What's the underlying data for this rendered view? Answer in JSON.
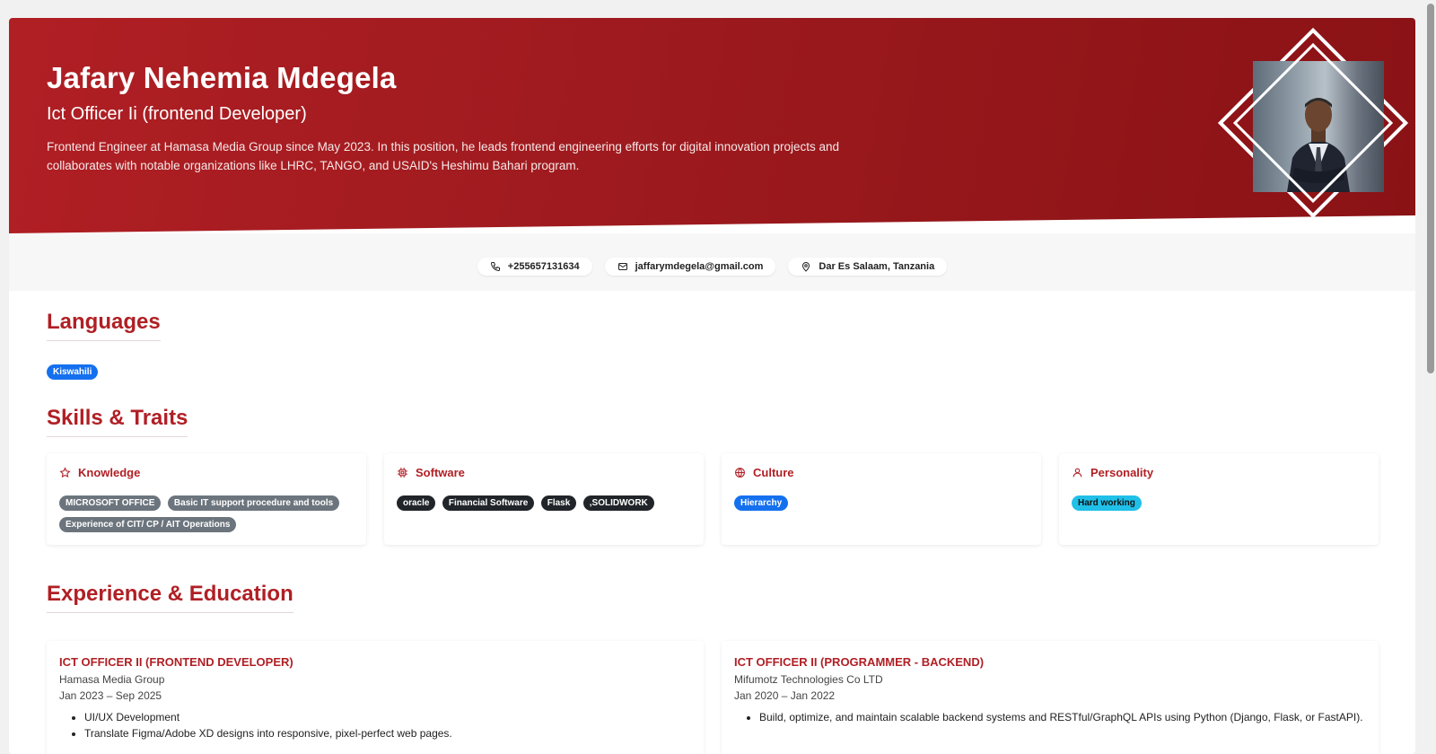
{
  "hero": {
    "name": "Jafary Nehemia Mdegela",
    "title": "Ict Officer Ii (frontend Developer)",
    "bio_line1": "Frontend Engineer at Hamasa Media Group since May 2023. In this position, he leads frontend engineering efforts for digital innovation projects and",
    "bio_line2": "collaborates with notable organizations like LHRC, TANGO, and USAID's Heshimu Bahari program."
  },
  "contacts": {
    "phone": "+255657131634",
    "email": "jaffarymdegela@gmail.com",
    "location": "Dar Es Salaam, Tanzania"
  },
  "languages": {
    "heading": "Languages",
    "items": [
      "Kiswahili"
    ]
  },
  "skills": {
    "heading": "Skills & Traits",
    "knowledge": {
      "label": "Knowledge",
      "items": [
        "MICROSOFT OFFICE",
        "Basic IT support procedure and tools",
        "Experience of CIT/ CP / AIT Operations"
      ]
    },
    "software": {
      "label": "Software",
      "items": [
        "oracle",
        "Financial Software",
        "Flask",
        ",SOLIDWORK"
      ]
    },
    "culture": {
      "label": "Culture",
      "items": [
        "Hierarchy"
      ]
    },
    "personality": {
      "label": "Personality",
      "items": [
        "Hard working"
      ]
    }
  },
  "experience": {
    "heading": "Experience & Education",
    "items": [
      {
        "role": "ICT OFFICER II (FRONTEND DEVELOPER)",
        "org": "Hamasa Media Group",
        "dates": "Jan 2023 – Sep 2025",
        "bullets": [
          "UI/UX Development",
          "Translate Figma/Adobe XD designs into responsive, pixel-perfect web pages."
        ]
      },
      {
        "role": "ICT OFFICER II (PROGRAMMER - BACKEND)",
        "org": "Mifumotz Technologies Co LTD",
        "dates": "Jan 2020 – Jan 2022",
        "bullets": [
          "Build, optimize, and maintain scalable backend systems and RESTful/GraphQL APIs using Python (Django, Flask, or FastAPI)."
        ]
      }
    ]
  },
  "colors": {
    "accent": "#b01f24",
    "tag_blue": "#1570ef",
    "tag_gray": "#6c757d",
    "tag_dark": "#212529",
    "tag_cyan": "#20c0e8"
  },
  "icons": {
    "phone": "phone-icon",
    "email": "mail-icon",
    "location": "map-pin-icon",
    "knowledge": "star-icon",
    "software": "chip-icon",
    "culture": "globe-icon",
    "personality": "user-icon"
  }
}
